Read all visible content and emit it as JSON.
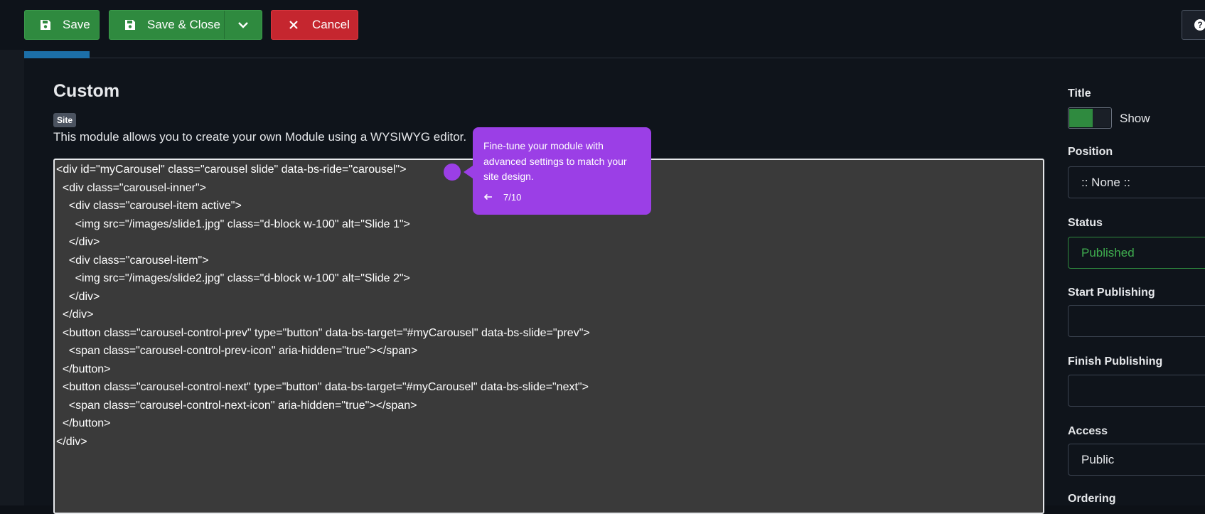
{
  "toolbar": {
    "save_label": "Save",
    "save_close_label": "Save & Close",
    "cancel_label": "Cancel",
    "help_symbol": "?"
  },
  "module": {
    "title": "Custom",
    "badge": "Site",
    "description": "This module allows you to create your own Module using a WYSIWYG editor."
  },
  "editor": {
    "lines": [
      "<div id=\"myCarousel\" class=\"carousel slide\" data-bs-ride=\"carousel\">",
      "  <div class=\"carousel-inner\">",
      "    <div class=\"carousel-item active\">",
      "      <img src=\"/images/slide1.jpg\" class=\"d-block w-100\" alt=\"Slide 1\">",
      "    </div>",
      "    <div class=\"carousel-item\">",
      "      <img src=\"/images/slide2.jpg\" class=\"d-block w-100\" alt=\"Slide 2\">",
      "    </div>",
      "  </div>",
      "  <button class=\"carousel-control-prev\" type=\"button\" data-bs-target=\"#myCarousel\" data-bs-slide=\"prev\">",
      "    <span class=\"carousel-control-prev-icon\" aria-hidden=\"true\"></span>",
      "  </button>",
      "  <button class=\"carousel-control-next\" type=\"button\" data-bs-target=\"#myCarousel\" data-bs-slide=\"next\">",
      "    <span class=\"carousel-control-next-icon\" aria-hidden=\"true\"></span>",
      "  </button>",
      "</div>"
    ]
  },
  "tooltip": {
    "text": "Fine-tune your module with advanced settings to match your site design.",
    "step": "7/10",
    "prev_icon": "arrow-left-icon",
    "accent": "#9b3fe6"
  },
  "sidebar": {
    "title_label": "Title",
    "title_toggle_label": "Show",
    "position_label": "Position",
    "position_value": ":: None ::",
    "status_label": "Status",
    "status_value": "Published",
    "start_publishing_label": "Start Publishing",
    "finish_publishing_label": "Finish Publishing",
    "access_label": "Access",
    "access_value": "Public",
    "ordering_label": "Ordering"
  },
  "colors": {
    "save_green": "#2f8a3f",
    "cancel_red": "#c5262f",
    "tab_blue": "#1c6fa8",
    "background": "#0f141b"
  }
}
